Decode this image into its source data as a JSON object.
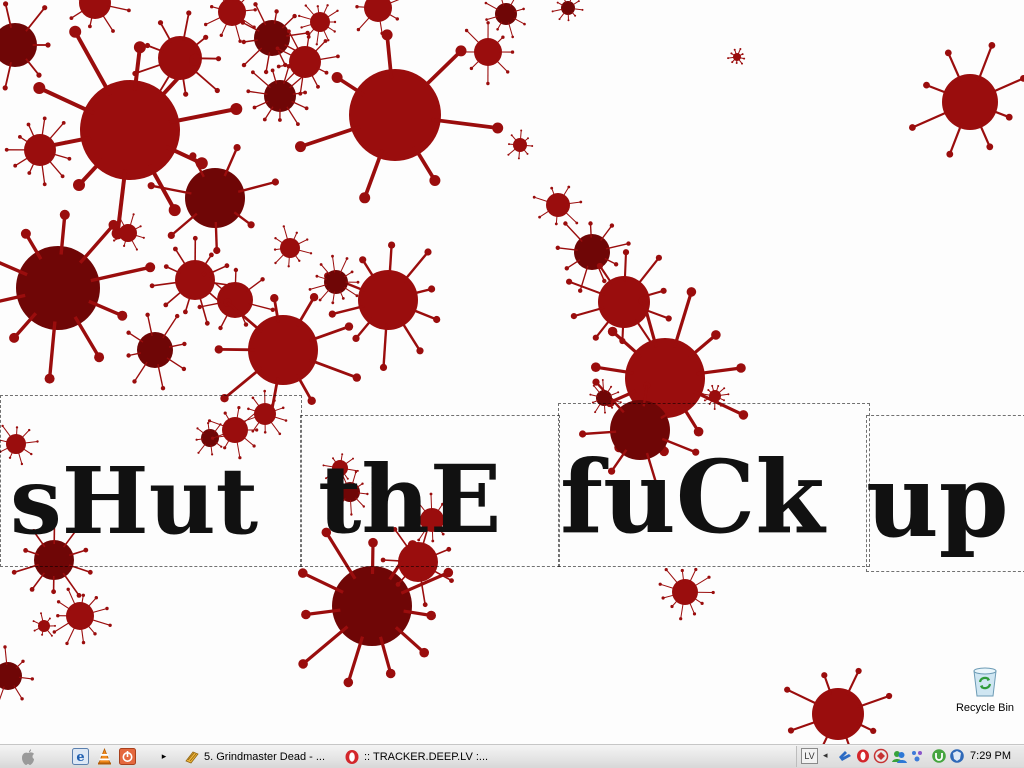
{
  "wallpaper": {
    "text_words": [
      {
        "text": "sHut"
      },
      {
        "text": "thE"
      },
      {
        "text": "fuCk"
      },
      {
        "text": "up"
      }
    ],
    "blood_color": "#9a0d0d",
    "blood_dark": "#6f0606"
  },
  "desktop_icons": {
    "recycle_bin": {
      "label": "Recycle Bin",
      "icon": "recycle-bin-icon"
    }
  },
  "taskbar": {
    "start_icon": "apple-icon",
    "quick_launch": [
      {
        "name": "ie-icon"
      },
      {
        "name": "vlc-icon"
      },
      {
        "name": "power-icon"
      }
    ],
    "overflow_arrow": "▸",
    "tasks": [
      {
        "label": "5. Grindmaster Dead - ...",
        "icon": "winamp-icon"
      },
      {
        "label": ":: TRACKER.DEEP.LV :...",
        "icon": "opera-icon"
      }
    ],
    "tray": {
      "language": "LV",
      "collapse_arrow": "◂",
      "icons": [
        "network-icon",
        "opera-tray-icon",
        "antivirus-icon",
        "messenger-icon",
        "bluetooth-icon",
        "utorrent-icon",
        "shield-icon"
      ],
      "clock": "7:29 PM"
    }
  }
}
